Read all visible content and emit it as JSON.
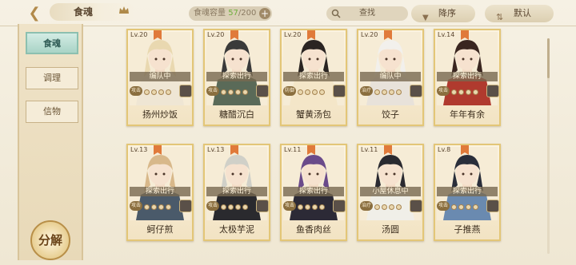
{
  "topbar": {
    "title": "食魂",
    "capacity_label": "食魂容量",
    "capacity_current": "57",
    "capacity_total": "/200",
    "capacity_plus": "+",
    "search_label": "查找",
    "sort_label": "降序",
    "filter_label": "默认"
  },
  "sidebar": {
    "tabs": [
      {
        "label": "食魂",
        "active": true
      },
      {
        "label": "调理",
        "active": false
      },
      {
        "label": "信物",
        "active": false
      }
    ],
    "decompose_label": "分解"
  },
  "colors": {
    "accent_teal": "#a9d4c6",
    "card_border": "#e3c677",
    "status_bar": "#78694f"
  },
  "characters": [
    {
      "level": "Lv.20",
      "status": "编队中",
      "tag": "攻击",
      "name": "扬州炒饭",
      "hair": "#e9d8b0",
      "robe": "#efe6d4"
    },
    {
      "level": "Lv.20",
      "status": "探索出行",
      "tag": "攻击",
      "name": "糖醋沉白",
      "hair": "#3a3a3a",
      "robe": "#5a6a58"
    },
    {
      "level": "Lv.20",
      "status": "探索出行",
      "tag": "防御",
      "name": "蟹黄汤包",
      "hair": "#2a2422",
      "robe": "#f4e6c8"
    },
    {
      "level": "Lv.20",
      "status": "编队中",
      "tag": "治疗",
      "name": "饺子",
      "hair": "#f2f0ec",
      "robe": "#e8e2da"
    },
    {
      "level": "Lv.14",
      "status": "探索出行",
      "tag": "攻击",
      "name": "年年有余",
      "hair": "#3a2620",
      "robe": "#b03a2e"
    },
    {
      "level": "Lv.13",
      "status": "探索出行",
      "tag": "攻击",
      "name": "蚵仔煎",
      "hair": "#d8b88a",
      "robe": "#4a5a6a"
    },
    {
      "level": "Lv.13",
      "status": "探索出行",
      "tag": "攻击",
      "name": "太极芋泥",
      "hair": "#d0d0c8",
      "robe": "#2a2a2e"
    },
    {
      "level": "Lv.11",
      "status": "探索出行",
      "tag": "攻击",
      "name": "鱼香肉丝",
      "hair": "#6a4a8a",
      "robe": "#2c2a36"
    },
    {
      "level": "Lv.11",
      "status": "小屋休息中",
      "tag": "治疗",
      "name": "汤圆",
      "hair": "#2a2a30",
      "robe": "#f0efe8"
    },
    {
      "level": "Lv.8",
      "status": "探索出行",
      "tag": "攻击",
      "name": "子推燕",
      "hair": "#2a2e3a",
      "robe": "#6a8ab0"
    }
  ]
}
